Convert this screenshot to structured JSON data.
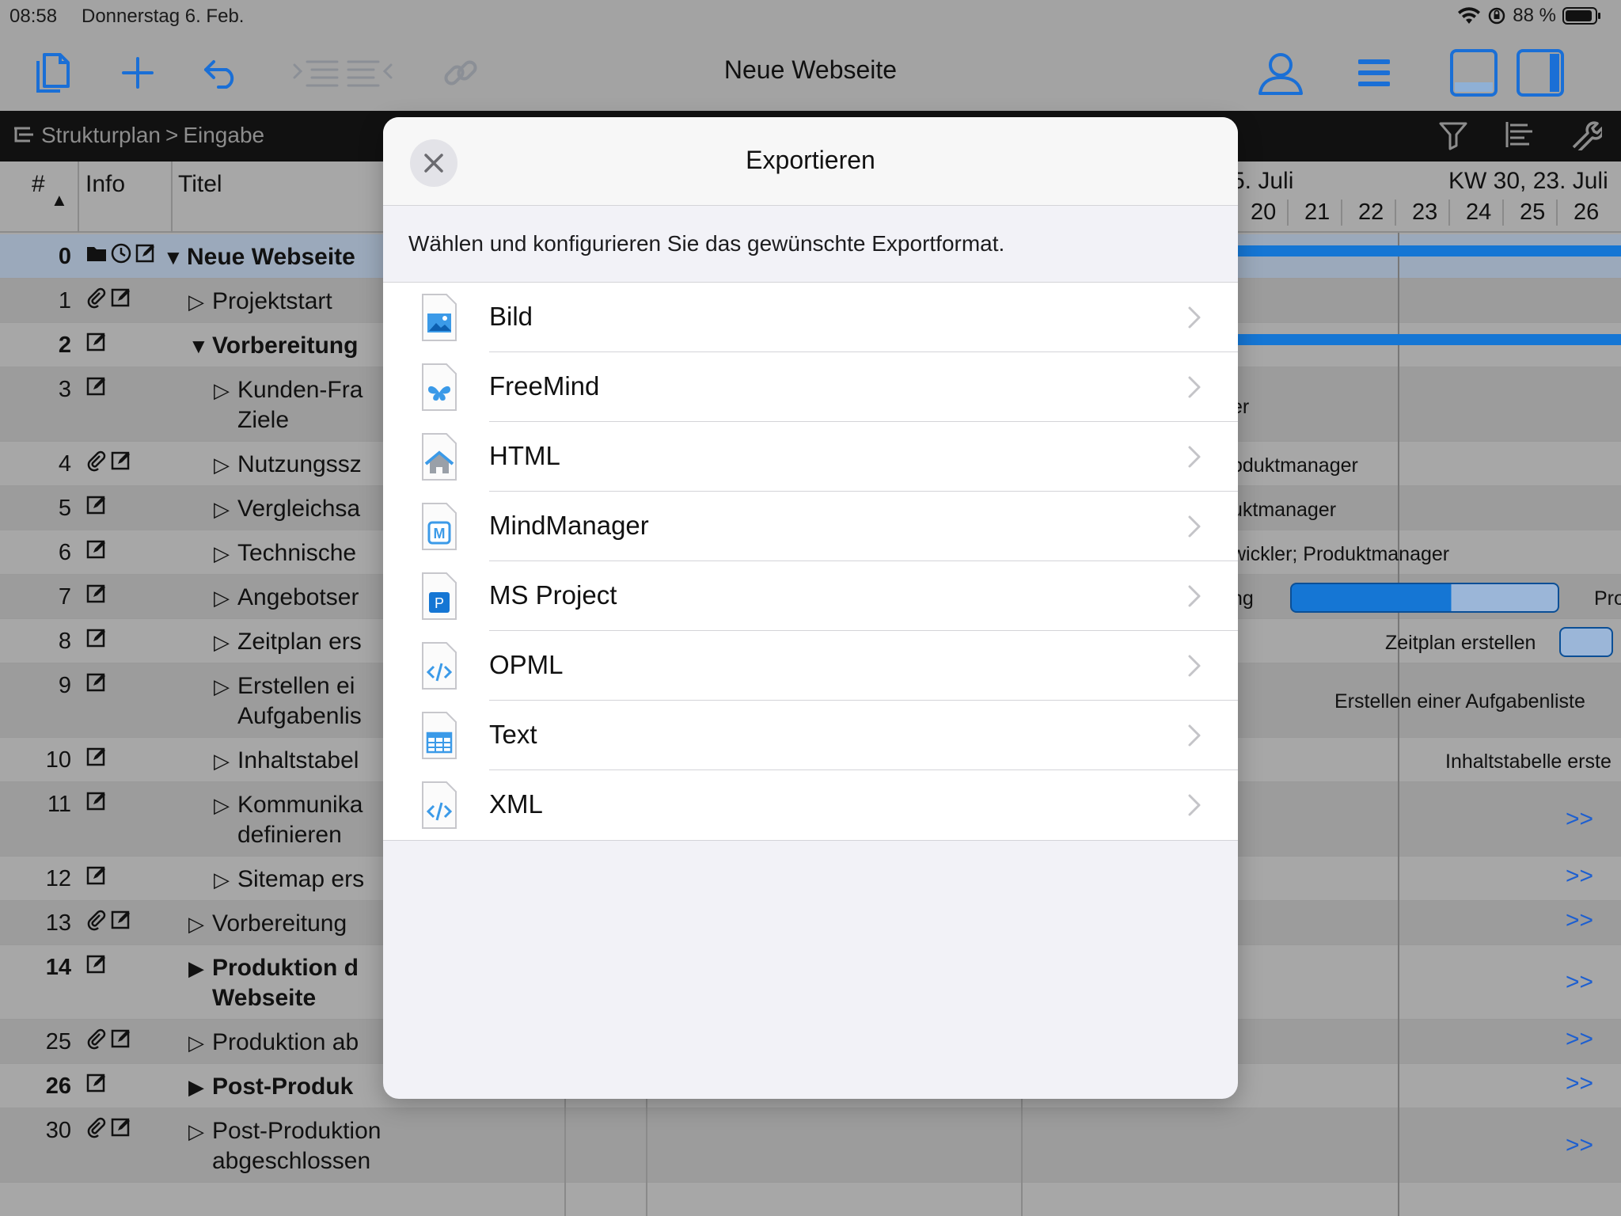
{
  "status": {
    "time": "08:58",
    "date": "Donnerstag 6. Feb.",
    "battery": "88 %"
  },
  "toolbar": {
    "title": "Neue Webseite"
  },
  "breadcrumb": {
    "root": "Strukturplan",
    "sep": ">",
    "current": "Eingabe"
  },
  "grid": {
    "headers": {
      "num": "#",
      "info": "Info",
      "title": "Titel",
      "week_a": "5. Juli",
      "week_b": "KW 30, 23. Juli"
    },
    "days": [
      "20",
      "21",
      "22",
      "23",
      "24",
      "25",
      "26"
    ],
    "rows": [
      {
        "num": "0",
        "title": "Neue Webseite",
        "tri": "▼",
        "bold": true
      },
      {
        "num": "1",
        "title": "Projektstart",
        "tri": "▷",
        "bold": false
      },
      {
        "num": "2",
        "title": "Vorbereitung",
        "tri": "▼",
        "bold": true
      },
      {
        "num": "3",
        "title": "Kunden-Fra\nZiele",
        "tri": "▷",
        "bold": false
      },
      {
        "num": "4",
        "title": "Nutzungssz",
        "tri": "▷",
        "bold": false
      },
      {
        "num": "5",
        "title": "Vergleichsa",
        "tri": "▷",
        "bold": false
      },
      {
        "num": "6",
        "title": "Technische",
        "tri": "▷",
        "bold": false
      },
      {
        "num": "7",
        "title": "Angebotser",
        "tri": "▷",
        "bold": false
      },
      {
        "num": "8",
        "title": "Zeitplan ers",
        "tri": "▷",
        "bold": false
      },
      {
        "num": "9",
        "title": "Erstellen ei\nAufgabenlis",
        "tri": "▷",
        "bold": false
      },
      {
        "num": "10",
        "title": "Inhaltstabel",
        "tri": "▷",
        "bold": false
      },
      {
        "num": "11",
        "title": "Kommunika\ndefinieren",
        "tri": "▷",
        "bold": false
      },
      {
        "num": "12",
        "title": "Sitemap ers",
        "tri": "▷",
        "bold": false
      },
      {
        "num": "13",
        "title": "Vorbereitung",
        "tri": "▷",
        "bold": false
      },
      {
        "num": "14",
        "title": "Produktion d\nWebseite",
        "tri": "▶",
        "bold": true
      },
      {
        "num": "25",
        "title": "Produktion ab",
        "tri": "▷",
        "bold": false
      },
      {
        "num": "26",
        "title": "Post-Produk",
        "tri": "▶",
        "bold": true
      },
      {
        "num": "30",
        "title": "Post-Produktion\nabgeschlossen",
        "tri": "▷",
        "bold": false
      }
    ],
    "gantt_labels": {
      "l3": "er",
      "l4": "oduktmanager",
      "l5": "uktmanager",
      "l6": "wickler; Produktmanager",
      "l7": "ng",
      "l7b": "Pro",
      "l8": "Zeitplan erstellen",
      "l9": "Erstellen einer Aufgabenliste",
      "l10": "Inhaltstabelle erste"
    },
    "more": ">>"
  },
  "modal": {
    "title": "Exportieren",
    "description": "Wählen und konfigurieren Sie das gewünschte Exportformat.",
    "items": [
      {
        "label": "Bild",
        "icon": "image-file-icon"
      },
      {
        "label": "FreeMind",
        "icon": "freemind-file-icon"
      },
      {
        "label": "HTML",
        "icon": "html-file-icon"
      },
      {
        "label": "MindManager",
        "icon": "mindmanager-file-icon"
      },
      {
        "label": "MS Project",
        "icon": "msproject-file-icon"
      },
      {
        "label": "OPML",
        "icon": "code-file-icon"
      },
      {
        "label": "Text",
        "icon": "table-file-icon"
      },
      {
        "label": "XML",
        "icon": "code-file-icon"
      }
    ]
  },
  "colors": {
    "accent": "#1576d4",
    "toolbar_icon": "#1a6fd6",
    "disabled": "#8b8f96"
  }
}
